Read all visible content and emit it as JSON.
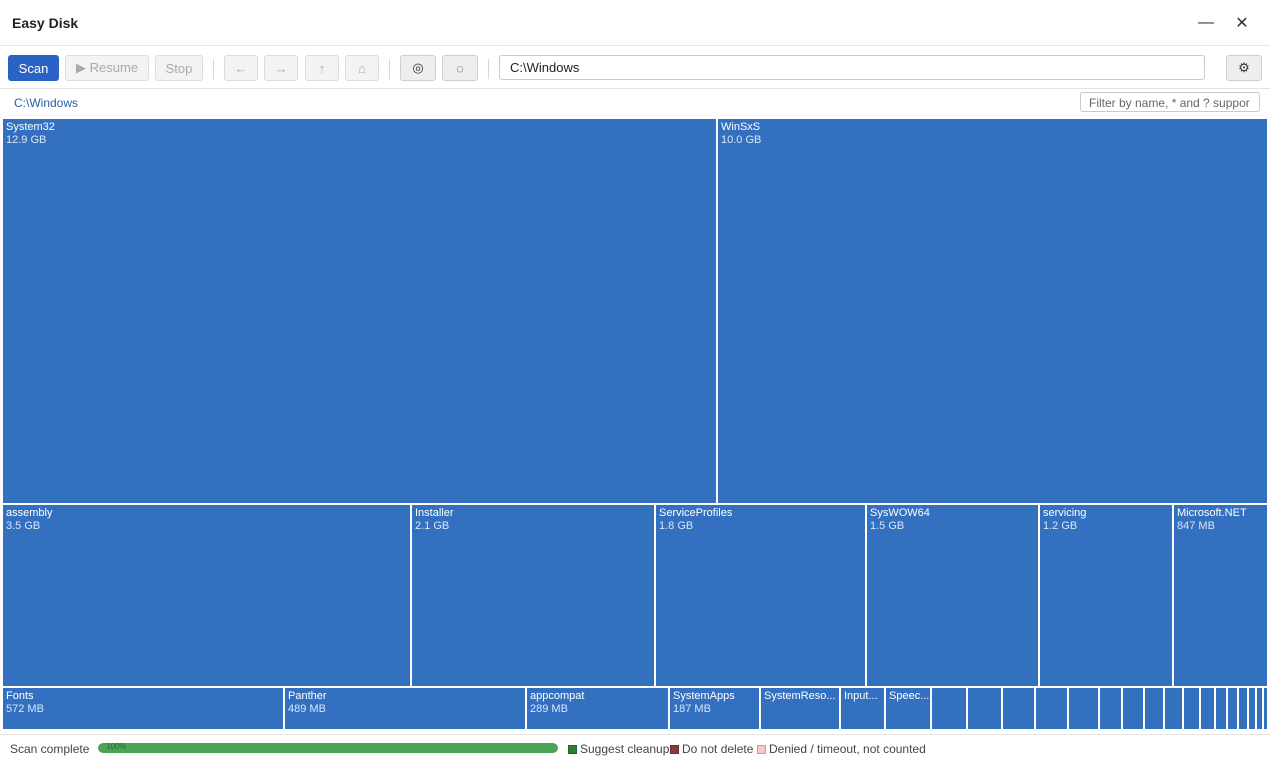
{
  "app": {
    "title": "Easy Disk"
  },
  "window": {
    "minimize": "—",
    "close": "✕"
  },
  "toolbar": {
    "scan": "Scan",
    "resume": "▶ Resume",
    "stop": "Stop",
    "back": "←",
    "forward": "→",
    "up": "↑",
    "home": "⌂",
    "target_icon": "◎",
    "dotted_icon": "◌",
    "settings_icon": "⚙",
    "path": "C:\\Windows"
  },
  "breadcrumb": {
    "path": "C:\\Windows"
  },
  "filter": {
    "placeholder": "Filter by name, * and ? suppor"
  },
  "treemap": {
    "tiles": [
      {
        "name": "System32",
        "size": "12.9 GB"
      },
      {
        "name": "WinSxS",
        "size": "10.0 GB"
      },
      {
        "name": "assembly",
        "size": "3.5 GB"
      },
      {
        "name": "Installer",
        "size": "2.1 GB"
      },
      {
        "name": "ServiceProfiles",
        "size": "1.8 GB"
      },
      {
        "name": "SysWOW64",
        "size": "1.5 GB"
      },
      {
        "name": "servicing",
        "size": "1.2 GB"
      },
      {
        "name": "Microsoft.NET",
        "size": "847 MB"
      },
      {
        "name": "Fonts",
        "size": "572 MB"
      },
      {
        "name": "Panther",
        "size": "489 MB"
      },
      {
        "name": "appcompat",
        "size": "289 MB"
      },
      {
        "name": "SystemApps",
        "size": "187 MB"
      },
      {
        "name": "SystemReso...",
        "size": ""
      },
      {
        "name": "Input...",
        "size": ""
      },
      {
        "name": "Speec...",
        "size": ""
      }
    ]
  },
  "status": {
    "text": "Scan complete",
    "progress_label": "100%",
    "progress_fraction": 1.0,
    "legend": [
      {
        "label": "Suggest cleanup",
        "color": "#2e7d32"
      },
      {
        "label": "Do not delete",
        "color": "#8b3a3a"
      },
      {
        "label": "Denied / timeout, not counted",
        "color": "#f3c9c9"
      }
    ]
  },
  "colors": {
    "accent": "#2a63c5",
    "tile": "#3370c0",
    "progress": "#4aa357"
  }
}
